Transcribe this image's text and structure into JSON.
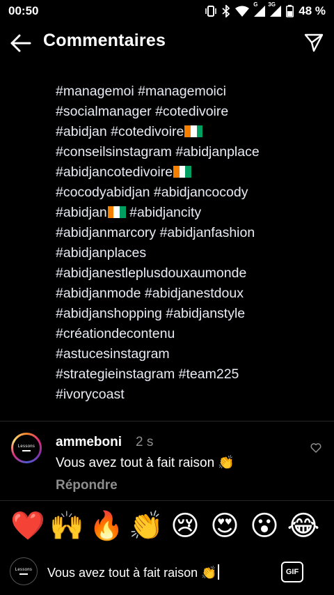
{
  "status_bar": {
    "time": "00:50",
    "battery_text": "48 %",
    "network_label": "G",
    "network_label_2": "3G",
    "icons": [
      "vibrate-icon",
      "bluetooth-icon",
      "wifi-icon",
      "signal-icon",
      "signal-icon",
      "battery-icon"
    ]
  },
  "header": {
    "title": "Commentaires",
    "back_icon": "arrow-left-icon",
    "send_icon": "paper-plane-icon"
  },
  "caption": {
    "lines": [
      "#managemoi #managemoici",
      "#socialmanager #cotedivoire",
      "#abidjan #cotedivoire",
      "#conseilsinstagram #abidjanplace",
      "#abidjancotedivoire",
      "#cocodyabidjan #abidjancocody",
      "#abidjan",
      "#abidjanmarcory #abidjanfashion",
      "#abidjanplaces",
      "#abidjanestleplusdouxaumonde",
      "#abidjanmode #abidjanestdoux",
      "#abidjanshopping #abidjanstyle",
      "#créationdecontenu",
      "#astucesinstagram",
      "#strategieinstagram #team225",
      "#ivorycoast"
    ],
    "line_7_suffix": "#abidjancity",
    "flag_colors": [
      "#f77f00",
      "#ffffff",
      "#009e60"
    ]
  },
  "comment": {
    "avatar_text": "Lessons",
    "username": "ammeboni",
    "time": "2 s",
    "text": "Vous avez tout à fait raison 👏",
    "reply_label": "Répondre",
    "like_icon": "heart-outline-icon"
  },
  "emoji_bar": [
    "❤️",
    "🙌",
    "🔥",
    "👏",
    "😢",
    "😍",
    "😮",
    "😂"
  ],
  "input": {
    "avatar_text": "Lessons",
    "value": "Vous avez tout à fait raison 👏",
    "gif_label": "GIF"
  },
  "colors": {
    "background": "#000000",
    "text": "#ffffff",
    "secondary": "#8e8e8e",
    "divider": "#262626"
  }
}
